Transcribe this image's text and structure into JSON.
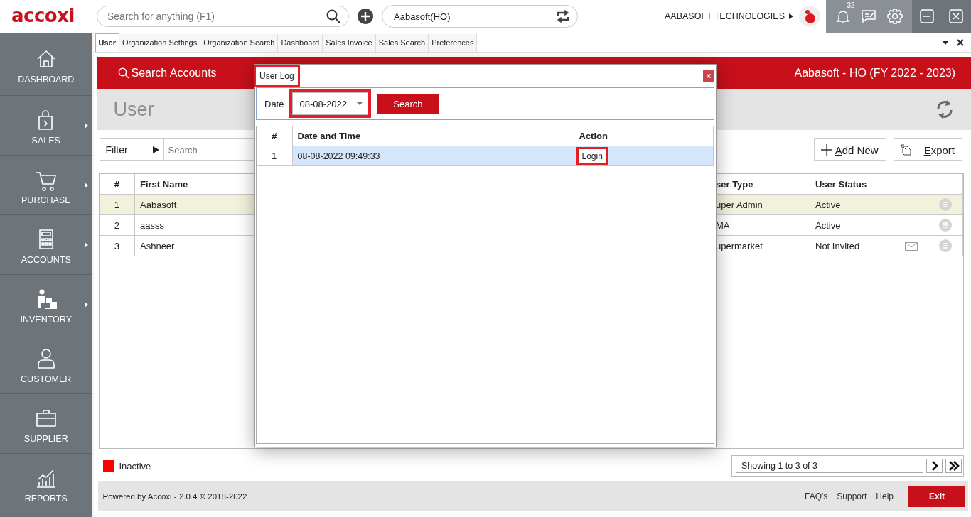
{
  "app": {
    "logo": "accoxi",
    "search_placeholder": "Search for anything (F1)",
    "organization": "Aabasoft(HO)",
    "company": "AABASOFT TECHNOLOGIES",
    "notification_count": "32"
  },
  "sidebar": {
    "items": [
      {
        "label": "DASHBOARD",
        "has_submenu": false
      },
      {
        "label": "SALES",
        "has_submenu": true
      },
      {
        "label": "PURCHASE",
        "has_submenu": true
      },
      {
        "label": "ACCOUNTS",
        "has_submenu": true
      },
      {
        "label": "INVENTORY",
        "has_submenu": true
      },
      {
        "label": "CUSTOMER",
        "has_submenu": false
      },
      {
        "label": "SUPPLIER",
        "has_submenu": false
      },
      {
        "label": "REPORTS",
        "has_submenu": false
      }
    ]
  },
  "tabs": [
    {
      "label": "User",
      "selected": true
    },
    {
      "label": "Organization Settings",
      "selected": false
    },
    {
      "label": "Organization Search",
      "selected": false
    },
    {
      "label": "Dashboard",
      "selected": false
    },
    {
      "label": "Sales Invoice",
      "selected": false
    },
    {
      "label": "Sales Search",
      "selected": false
    },
    {
      "label": "Preferences",
      "selected": false
    }
  ],
  "header": {
    "search_label": "Search Accounts",
    "org_title": "Aabasoft - HO (FY 2022 - 2023)"
  },
  "page": {
    "title": "User",
    "filter_label": "Filter",
    "search_placeholder": "Search",
    "add_button": "Add New",
    "export_button": "Export"
  },
  "table": {
    "num_header": "#",
    "first_name_header": "First Name",
    "user_type_header": "ser Type",
    "user_status_header": "User Status",
    "rows": [
      {
        "num": "1",
        "first_name": "Aabasoft",
        "user_type": "uper Admin",
        "user_status": "Active",
        "mail_icon": false,
        "selected": true
      },
      {
        "num": "2",
        "first_name": "aasss",
        "user_type": "MA",
        "user_status": "Active",
        "mail_icon": false,
        "selected": false
      },
      {
        "num": "3",
        "first_name": "Ashneer",
        "user_type": "upermarket",
        "user_status": "Not Invited",
        "mail_icon": true,
        "selected": false
      }
    ]
  },
  "legend": {
    "label": "Inactive",
    "color": "#ff0000"
  },
  "pagination": {
    "info": "Showing 1 to 3 of 3"
  },
  "footer": {
    "powered_by": "Powered by Accoxi - 2.0.4 © 2018-2022",
    "links": [
      "FAQ's",
      "Support",
      "Help"
    ],
    "exit_button": "Exit"
  },
  "dialog": {
    "title": "User Log",
    "title_highlighted": true,
    "date_label": "Date",
    "date_value": "08-08-2022",
    "date_highlighted": true,
    "search_button": "Search",
    "num_header": "#",
    "date_time_header": "Date and Time",
    "action_header": "Action",
    "rows": [
      {
        "num": "1",
        "date_time": "08-08-2022 09:49:33",
        "action": "Login",
        "selected": true,
        "action_highlighted": true
      }
    ]
  }
}
